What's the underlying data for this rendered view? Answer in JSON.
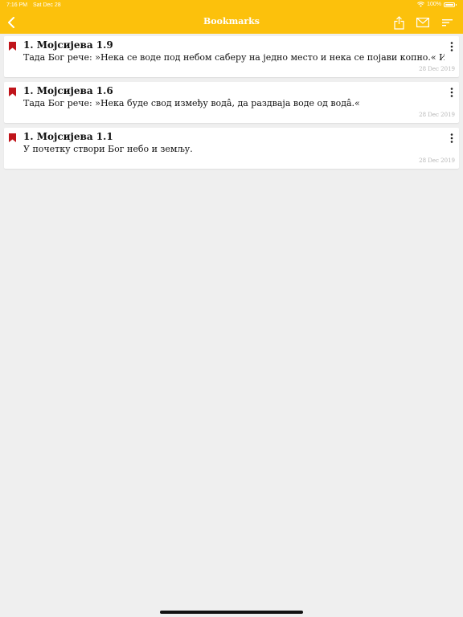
{
  "status_bar": {
    "time": "7:16 PM",
    "date": "Sat Dec 28",
    "battery": "100%"
  },
  "nav": {
    "title": "Bookmarks"
  },
  "colors": {
    "header": "#fcc10c",
    "bookmark": "#c0151b",
    "background": "#efefef"
  },
  "bookmarks": [
    {
      "reference": "1. Мојсијева 1.9",
      "text": "Тада Бог рече: »Нека се воде под небом саберу на једно место и нека се појави копно.« И би тако.",
      "date": "28 Dec 2019"
    },
    {
      "reference": "1. Мојсијева 1.6",
      "text": "Тада Бог рече: »Нека буде свод између водâ, да раздваја воде од водâ.«",
      "date": "28 Dec 2019"
    },
    {
      "reference": "1. Мојсијева 1.1",
      "text": "У почетку створи Бог небо и земљу.",
      "date": "28 Dec 2019"
    }
  ]
}
